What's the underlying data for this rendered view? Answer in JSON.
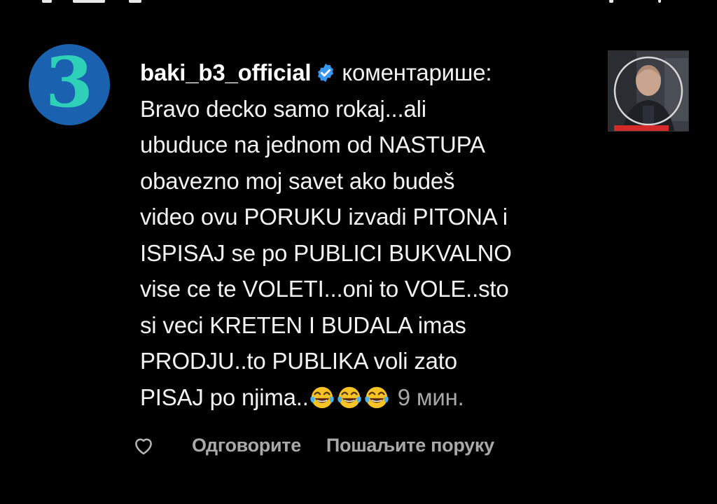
{
  "comment": {
    "username": "baki_b3_official",
    "action_text": "коментарише:",
    "text": "Bravo decko samo rokaj...ali\nubuduce na jednom od NASTUPA\nobavezno moj savet ako budeš\nvideo ovu PORUKU izvadi PITONA i\nISPISAJ se po PUBLICI BUKVALNO\nvise ce te VOLETI...oni to VOLE..sto\nsi veci KRETEN I BUDALA imas\nPRODJU..to PUBLIKA voli zato\nPISAJ po njima..",
    "emojis": [
      "face-with-tears-of-joy-icon",
      "face-with-tears-of-joy-icon",
      "face-with-tears-of-joy-icon"
    ],
    "time": "9 мин."
  },
  "avatar": {
    "glyph": "3",
    "bg_color": "#1a62b0",
    "glyph_color": "#2ed1b8"
  },
  "actions": {
    "reply_label": "Одговорите",
    "send_message_label": "Пошаљите поруку"
  },
  "colors": {
    "background": "#000000",
    "verified_badge": "#3897f0",
    "secondary_text": "#a9a9a9"
  }
}
